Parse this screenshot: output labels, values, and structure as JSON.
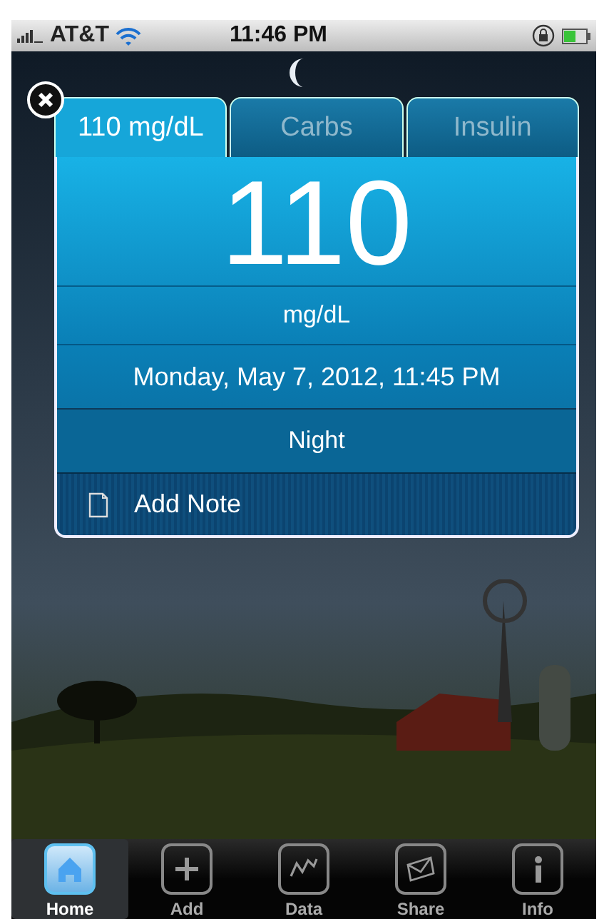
{
  "status_bar": {
    "carrier": "AT&T",
    "time": "11:46 PM"
  },
  "tabs": [
    {
      "label": "110 mg/dL",
      "selected": true
    },
    {
      "label": "Carbs",
      "selected": false
    },
    {
      "label": "Insulin",
      "selected": false
    }
  ],
  "reading": {
    "value": "110",
    "unit": "mg/dL",
    "datetime": "Monday, May 7, 2012, 11:45 PM",
    "period": "Night"
  },
  "note_button": {
    "label": "Add Note"
  },
  "tab_bar": [
    {
      "label": "Home",
      "kind": "home",
      "selected": true
    },
    {
      "label": "Add",
      "kind": "add",
      "selected": false
    },
    {
      "label": "Data",
      "kind": "data",
      "selected": false
    },
    {
      "label": "Share",
      "kind": "share",
      "selected": false
    },
    {
      "label": "Info",
      "kind": "info",
      "selected": false
    }
  ]
}
